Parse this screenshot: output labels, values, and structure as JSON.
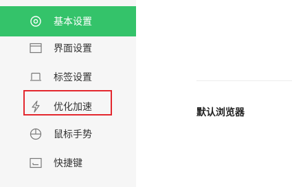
{
  "sidebar": {
    "items": [
      {
        "label": "基本设置",
        "icon": "target-icon",
        "active": true
      },
      {
        "label": "界面设置",
        "icon": "window-icon",
        "active": false
      },
      {
        "label": "标签设置",
        "icon": "tab-icon",
        "active": false
      },
      {
        "label": "优化加速",
        "icon": "lightning-icon",
        "active": false,
        "highlighted": true
      },
      {
        "label": "鼠标手势",
        "icon": "mouse-icon",
        "active": false
      },
      {
        "label": "快捷键",
        "icon": "keyboard-icon",
        "active": false
      }
    ]
  },
  "main": {
    "section_title": "默认浏览器"
  },
  "colors": {
    "accent": "#34c36a",
    "highlight_border": "#e3262d",
    "sidebar_bg": "#f6f6f6"
  }
}
